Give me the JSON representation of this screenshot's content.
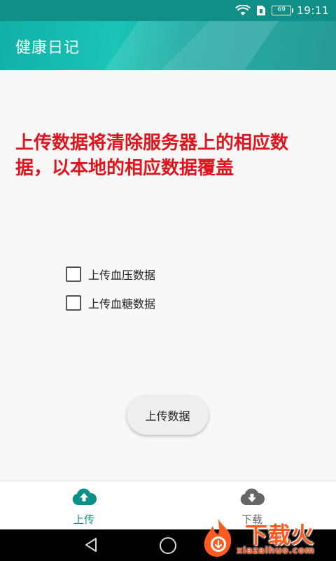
{
  "status_bar": {
    "battery": "69",
    "time": "19:11",
    "icons": [
      "wifi-icon",
      "sim-card-icon",
      "battery-icon"
    ]
  },
  "app_bar": {
    "title": "健康日记"
  },
  "warning": {
    "text": "上传数据将清除服务器上的相应数据，以本地的相应数据覆盖"
  },
  "options": [
    {
      "label": "上传血压数据",
      "checked": false
    },
    {
      "label": "上传血糖数据",
      "checked": false
    }
  ],
  "upload_button": {
    "label": "上传数据"
  },
  "bottom_nav": {
    "items": [
      {
        "label": "上传",
        "icon": "cloud-upload-icon",
        "active": true
      },
      {
        "label": "下载",
        "icon": "cloud-download-icon",
        "active": false
      }
    ]
  },
  "colors": {
    "primary": "#0f8f86",
    "warning": "#e0141c",
    "watermark": "#ff5a1f"
  },
  "watermark": {
    "text": "下载火",
    "url": "xiazaihuo.com"
  }
}
